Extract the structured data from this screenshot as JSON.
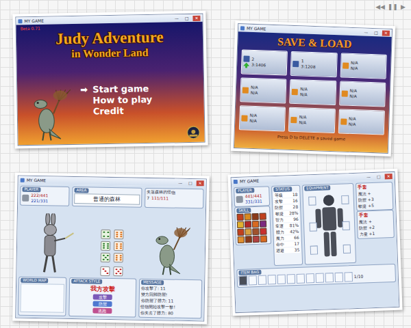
{
  "player_controls": [
    "◀◀",
    "❚❚",
    "▶"
  ],
  "title_screen": {
    "window_title": "MY GAME",
    "window_buttons": [
      "—",
      "□",
      "✕"
    ],
    "version": "Beta 0.71",
    "title": "Judy Adventure",
    "subtitle": "in Wonder Land",
    "cursor": "➡",
    "menu": [
      {
        "label": "Start game",
        "selected": true
      },
      {
        "label": "How to play",
        "selected": false
      },
      {
        "label": "Credit",
        "selected": false
      }
    ]
  },
  "save_screen": {
    "window_title": "MY GAME",
    "window_buttons": [
      "—",
      "□",
      "✕"
    ],
    "heading": "SAVE & LOAD",
    "slots": [
      {
        "number": "2",
        "time": "3:1406",
        "empty": false,
        "selected": true
      },
      {
        "number": "1",
        "time": "3:1208",
        "empty": false,
        "selected": false
      },
      {
        "number": "N/A",
        "time": "N/A",
        "empty": true,
        "selected": false
      },
      {
        "number": "N/A",
        "time": "N/A",
        "empty": true,
        "selected": false
      },
      {
        "number": "N/A",
        "time": "N/A",
        "empty": true,
        "selected": false
      },
      {
        "number": "N/A",
        "time": "N/A",
        "empty": true,
        "selected": false
      },
      {
        "number": "N/A",
        "time": "N/A",
        "empty": true,
        "selected": false
      },
      {
        "number": "N/A",
        "time": "N/A",
        "empty": true,
        "selected": false
      },
      {
        "number": "N/A",
        "time": "N/A",
        "empty": true,
        "selected": false
      }
    ],
    "hint": "Press D to DELETE a saved game"
  },
  "battle_screen": {
    "window_title": "MY GAME",
    "window_buttons": [
      "—",
      "□",
      "✕"
    ],
    "player": {
      "label": "PLAYER",
      "hp": "222/441",
      "mp": "221/331"
    },
    "area": {
      "label": "AREA",
      "name": "普通的森林"
    },
    "monster": {
      "name": "失落森林的怪物",
      "level": "7",
      "hp": "111/111"
    },
    "player_dice": [
      4,
      6,
      5
    ],
    "monster_dice": [
      6,
      6,
      6
    ],
    "rolled_dice": [
      3,
      5
    ],
    "world_map": {
      "label": "WORLD MAP"
    },
    "attack": {
      "label": "ATTACK STYLE",
      "title": "我方攻擊",
      "buttons": [
        {
          "label": "攻擊",
          "color": "#7a5ab8"
        },
        {
          "label": "防禦",
          "color": "#4f78d0"
        },
        {
          "label": "逃跑",
          "color": "#c0508f"
        }
      ]
    },
    "message": {
      "label": "MESSAGE",
      "lines": [
        "你攻擊了: 11",
        "雙方回歸防禦!",
        "你防禦了體力: 11",
        "怪物開始攻擊一擊!",
        "你失去了體力: 80"
      ]
    }
  },
  "status_screen": {
    "window_title": "MY GAME",
    "window_buttons": [
      "—",
      "□",
      "✕"
    ],
    "player": {
      "label": "PLAYER",
      "hp": "441/441",
      "mp": "331/331"
    },
    "stats_label": "STATUS",
    "stats": [
      {
        "label": "等級",
        "value": "18"
      },
      {
        "label": "攻擊",
        "value": "16"
      },
      {
        "label": "防禦",
        "value": "28"
      },
      {
        "label": "敏捷",
        "value": "28%"
      },
      {
        "label": "智力",
        "value": "96"
      },
      {
        "label": "幸運",
        "value": "81%"
      },
      {
        "label": "體力",
        "value": "42%"
      },
      {
        "label": "魔力",
        "value": "66"
      },
      {
        "label": "命中",
        "value": "17"
      },
      {
        "label": "迴避",
        "value": "35"
      }
    ],
    "skills_label": "SKILL",
    "skills": [
      {
        "color": "#c0401e"
      },
      {
        "color": "#d88a20"
      },
      {
        "color": "#8a3a1a"
      },
      {
        "color": "#c0401e"
      },
      {
        "color": "#e0b030"
      },
      {
        "color": "#b02828"
      },
      {
        "color": "#d86a20"
      },
      {
        "color": "#7a2a80"
      },
      {
        "color": "#c0401e"
      },
      {
        "color": "#d8a040"
      },
      {
        "color": "#a0522d"
      },
      {
        "color": "#c83030"
      },
      {
        "color": "#e09030"
      },
      {
        "color": "#8a3a1a"
      },
      {
        "color": "#b04040"
      },
      {
        "color": "#d86a20"
      }
    ],
    "equipment_label": "EQUIPMENT",
    "item_panels": [
      {
        "title": "手套",
        "lines": [
          "魔法 +",
          "防禦 +3",
          "敏捷 +5"
        ]
      },
      {
        "title": "手套",
        "lines": [
          "魔法 +",
          "防禦 +2",
          "力量 +1"
        ]
      }
    ],
    "bag": {
      "label": "ITEM BAG",
      "page": "1/10",
      "slots": [
        {
          "filled": true
        },
        {
          "filled": false
        },
        {
          "filled": false
        },
        {
          "filled": false
        },
        {
          "filled": false
        },
        {
          "filled": false
        },
        {
          "filled": false
        },
        {
          "filled": false
        },
        {
          "filled": false
        },
        {
          "filled": false
        },
        {
          "filled": false
        },
        {
          "filled": false
        }
      ]
    }
  }
}
